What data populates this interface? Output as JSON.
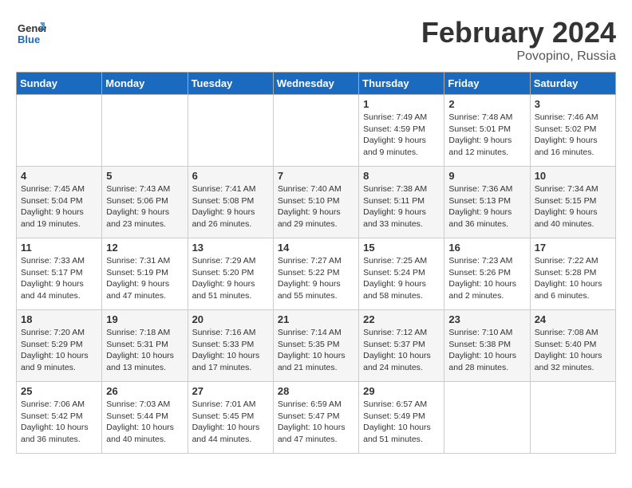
{
  "header": {
    "logo_line1": "General",
    "logo_line2": "Blue",
    "month_title": "February 2024",
    "location": "Povoрino, Russia"
  },
  "days_of_week": [
    "Sunday",
    "Monday",
    "Tuesday",
    "Wednesday",
    "Thursday",
    "Friday",
    "Saturday"
  ],
  "weeks": [
    [
      {
        "day": "",
        "info": ""
      },
      {
        "day": "",
        "info": ""
      },
      {
        "day": "",
        "info": ""
      },
      {
        "day": "",
        "info": ""
      },
      {
        "day": "1",
        "info": "Sunrise: 7:49 AM\nSunset: 4:59 PM\nDaylight: 9 hours\nand 9 minutes."
      },
      {
        "day": "2",
        "info": "Sunrise: 7:48 AM\nSunset: 5:01 PM\nDaylight: 9 hours\nand 12 minutes."
      },
      {
        "day": "3",
        "info": "Sunrise: 7:46 AM\nSunset: 5:02 PM\nDaylight: 9 hours\nand 16 minutes."
      }
    ],
    [
      {
        "day": "4",
        "info": "Sunrise: 7:45 AM\nSunset: 5:04 PM\nDaylight: 9 hours\nand 19 minutes."
      },
      {
        "day": "5",
        "info": "Sunrise: 7:43 AM\nSunset: 5:06 PM\nDaylight: 9 hours\nand 23 minutes."
      },
      {
        "day": "6",
        "info": "Sunrise: 7:41 AM\nSunset: 5:08 PM\nDaylight: 9 hours\nand 26 minutes."
      },
      {
        "day": "7",
        "info": "Sunrise: 7:40 AM\nSunset: 5:10 PM\nDaylight: 9 hours\nand 29 minutes."
      },
      {
        "day": "8",
        "info": "Sunrise: 7:38 AM\nSunset: 5:11 PM\nDaylight: 9 hours\nand 33 minutes."
      },
      {
        "day": "9",
        "info": "Sunrise: 7:36 AM\nSunset: 5:13 PM\nDaylight: 9 hours\nand 36 minutes."
      },
      {
        "day": "10",
        "info": "Sunrise: 7:34 AM\nSunset: 5:15 PM\nDaylight: 9 hours\nand 40 minutes."
      }
    ],
    [
      {
        "day": "11",
        "info": "Sunrise: 7:33 AM\nSunset: 5:17 PM\nDaylight: 9 hours\nand 44 minutes."
      },
      {
        "day": "12",
        "info": "Sunrise: 7:31 AM\nSunset: 5:19 PM\nDaylight: 9 hours\nand 47 minutes."
      },
      {
        "day": "13",
        "info": "Sunrise: 7:29 AM\nSunset: 5:20 PM\nDaylight: 9 hours\nand 51 minutes."
      },
      {
        "day": "14",
        "info": "Sunrise: 7:27 AM\nSunset: 5:22 PM\nDaylight: 9 hours\nand 55 minutes."
      },
      {
        "day": "15",
        "info": "Sunrise: 7:25 AM\nSunset: 5:24 PM\nDaylight: 9 hours\nand 58 minutes."
      },
      {
        "day": "16",
        "info": "Sunrise: 7:23 AM\nSunset: 5:26 PM\nDaylight: 10 hours\nand 2 minutes."
      },
      {
        "day": "17",
        "info": "Sunrise: 7:22 AM\nSunset: 5:28 PM\nDaylight: 10 hours\nand 6 minutes."
      }
    ],
    [
      {
        "day": "18",
        "info": "Sunrise: 7:20 AM\nSunset: 5:29 PM\nDaylight: 10 hours\nand 9 minutes."
      },
      {
        "day": "19",
        "info": "Sunrise: 7:18 AM\nSunset: 5:31 PM\nDaylight: 10 hours\nand 13 minutes."
      },
      {
        "day": "20",
        "info": "Sunrise: 7:16 AM\nSunset: 5:33 PM\nDaylight: 10 hours\nand 17 minutes."
      },
      {
        "day": "21",
        "info": "Sunrise: 7:14 AM\nSunset: 5:35 PM\nDaylight: 10 hours\nand 21 minutes."
      },
      {
        "day": "22",
        "info": "Sunrise: 7:12 AM\nSunset: 5:37 PM\nDaylight: 10 hours\nand 24 minutes."
      },
      {
        "day": "23",
        "info": "Sunrise: 7:10 AM\nSunset: 5:38 PM\nDaylight: 10 hours\nand 28 minutes."
      },
      {
        "day": "24",
        "info": "Sunrise: 7:08 AM\nSunset: 5:40 PM\nDaylight: 10 hours\nand 32 minutes."
      }
    ],
    [
      {
        "day": "25",
        "info": "Sunrise: 7:06 AM\nSunset: 5:42 PM\nDaylight: 10 hours\nand 36 minutes."
      },
      {
        "day": "26",
        "info": "Sunrise: 7:03 AM\nSunset: 5:44 PM\nDaylight: 10 hours\nand 40 minutes."
      },
      {
        "day": "27",
        "info": "Sunrise: 7:01 AM\nSunset: 5:45 PM\nDaylight: 10 hours\nand 44 minutes."
      },
      {
        "day": "28",
        "info": "Sunrise: 6:59 AM\nSunset: 5:47 PM\nDaylight: 10 hours\nand 47 minutes."
      },
      {
        "day": "29",
        "info": "Sunrise: 6:57 AM\nSunset: 5:49 PM\nDaylight: 10 hours\nand 51 minutes."
      },
      {
        "day": "",
        "info": ""
      },
      {
        "day": "",
        "info": ""
      }
    ]
  ]
}
